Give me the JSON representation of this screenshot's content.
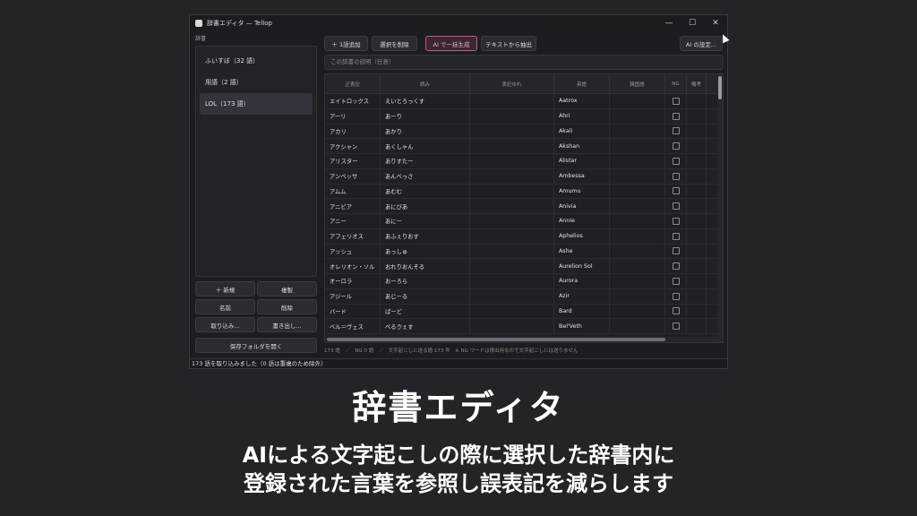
{
  "window": {
    "title": "辞書エディタ — Tellop",
    "minimize": "—",
    "maximize": "☐",
    "close": "✕"
  },
  "sidebar": {
    "label": "辞書",
    "items": [
      "ふいすぼ（32 語）",
      "用語（2 語）",
      "LOL（173 語）"
    ],
    "selected_index": 2,
    "buttons": {
      "new": "＋ 新規",
      "duplicate": "複製",
      "rename": "名前",
      "delete": "削除",
      "import": "取り込み...",
      "export": "書き出し...",
      "open_folder": "保存フォルダを開く"
    }
  },
  "toolbar": {
    "add_one": "＋ 1語追加",
    "delete_selected": "選択を削除",
    "ai_generate": "AI で一括生成",
    "extract_text": "テキストから抽出",
    "ai_settings": "AI の設定..."
  },
  "description_placeholder": "この辞書の説明（任意）",
  "table": {
    "headers": [
      "正表記",
      "読み",
      "表記ゆれ",
      "英語",
      "韓国語",
      "NG",
      "備考"
    ],
    "rows": [
      [
        "エイトロックス",
        "えいとろっくす",
        "",
        "Aatrox",
        ""
      ],
      [
        "アーリ",
        "あーり",
        "",
        "Ahri",
        ""
      ],
      [
        "アカリ",
        "あかり",
        "",
        "Akali",
        ""
      ],
      [
        "アクシャン",
        "あくしゃん",
        "",
        "Akshan",
        ""
      ],
      [
        "アリスター",
        "ありすたー",
        "",
        "Alistar",
        ""
      ],
      [
        "アンベッサ",
        "あんべっさ",
        "",
        "Ambessa",
        ""
      ],
      [
        "アムム",
        "あむむ",
        "",
        "Amumu",
        ""
      ],
      [
        "アニビア",
        "あにびあ",
        "",
        "Anivia",
        ""
      ],
      [
        "アニー",
        "あにー",
        "",
        "Annie",
        ""
      ],
      [
        "アフェリオス",
        "あふぇりおす",
        "",
        "Aphelios",
        ""
      ],
      [
        "アッシュ",
        "あっしゅ",
        "",
        "Ashe",
        ""
      ],
      [
        "オレリオン・ソル",
        "おれりおんそる",
        "",
        "Aurelion Sol",
        ""
      ],
      [
        "オーロラ",
        "おーろら",
        "",
        "Aurora",
        ""
      ],
      [
        "アジール",
        "あじーる",
        "",
        "Azir",
        ""
      ],
      [
        "バード",
        "ばーど",
        "",
        "Bard",
        ""
      ],
      [
        "ベル＝ヴェス",
        "べるゔぇす",
        "",
        "Bel'Veth",
        ""
      ]
    ]
  },
  "footer_info": "173 語　／　NG 0 語　／　文字起こしに送る語 173 件　※ NG ワードは検出用なので文字起こしには送りません",
  "status": "173 語を取り込みました（0 語は重複のため除外）",
  "caption": {
    "title": "辞書エディタ",
    "line1": "AIによる文字起こしの際に選択した辞書内に",
    "line2": "登録された言葉を参照し誤表記を減らします"
  }
}
